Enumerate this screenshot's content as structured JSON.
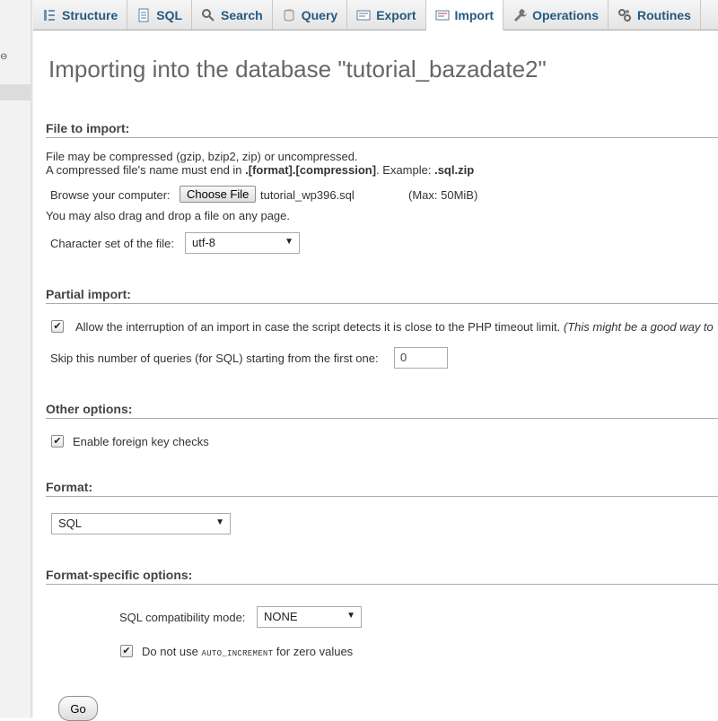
{
  "tabs": [
    {
      "label": "Structure",
      "icon": "structure-icon",
      "active": false
    },
    {
      "label": "SQL",
      "icon": "sql-icon",
      "active": false
    },
    {
      "label": "Search",
      "icon": "search-icon",
      "active": false
    },
    {
      "label": "Query",
      "icon": "query-icon",
      "active": false
    },
    {
      "label": "Export",
      "icon": "export-icon",
      "active": false
    },
    {
      "label": "Import",
      "icon": "import-icon",
      "active": true
    },
    {
      "label": "Operations",
      "icon": "operations-icon",
      "active": false
    },
    {
      "label": "Routines",
      "icon": "routines-icon",
      "active": false
    }
  ],
  "page_title": "Importing into the database \"tutorial_bazadate2\"",
  "file_import": {
    "heading": "File to import:",
    "compress_note": "File may be compressed (gzip, bzip2, zip) or uncompressed.",
    "name_note_prefix": "A compressed file's name must end in ",
    "name_note_format": ".[format].[compression]",
    "name_note_mid": ". Example: ",
    "name_note_example": ".sql.zip",
    "browse_label": "Browse your computer:",
    "choose_file_button": "Choose File",
    "file_name": "tutorial_wp396.sql",
    "max_size": "(Max: 50MiB)",
    "drag_note": "You may also drag and drop a file on any page.",
    "charset_label": "Character set of the file:",
    "charset_value": "utf-8"
  },
  "partial_import": {
    "heading": "Partial import:",
    "allow_interrupt_label": "Allow the interruption of an import in case the script detects it is close to the PHP timeout limit.",
    "allow_interrupt_note": "(This might be a good way to",
    "allow_interrupt_checked": true,
    "skip_label": "Skip this number of queries (for SQL) starting from the first one:",
    "skip_value": "0"
  },
  "other_options": {
    "heading": "Other options:",
    "foreign_key_label": "Enable foreign key checks",
    "foreign_key_checked": true
  },
  "format": {
    "heading": "Format:",
    "value": "SQL"
  },
  "format_specific": {
    "heading": "Format-specific options:",
    "compat_label": "SQL compatibility mode:",
    "compat_value": "NONE",
    "no_auto_inc_prefix": "Do not use ",
    "no_auto_inc_code": "AUTO_INCREMENT",
    "no_auto_inc_suffix": " for zero values",
    "no_auto_inc_checked": true
  },
  "go_button": "Go",
  "colors": {
    "tab_text": "#235a81",
    "heading_text": "#444444",
    "title_text": "#666666"
  }
}
